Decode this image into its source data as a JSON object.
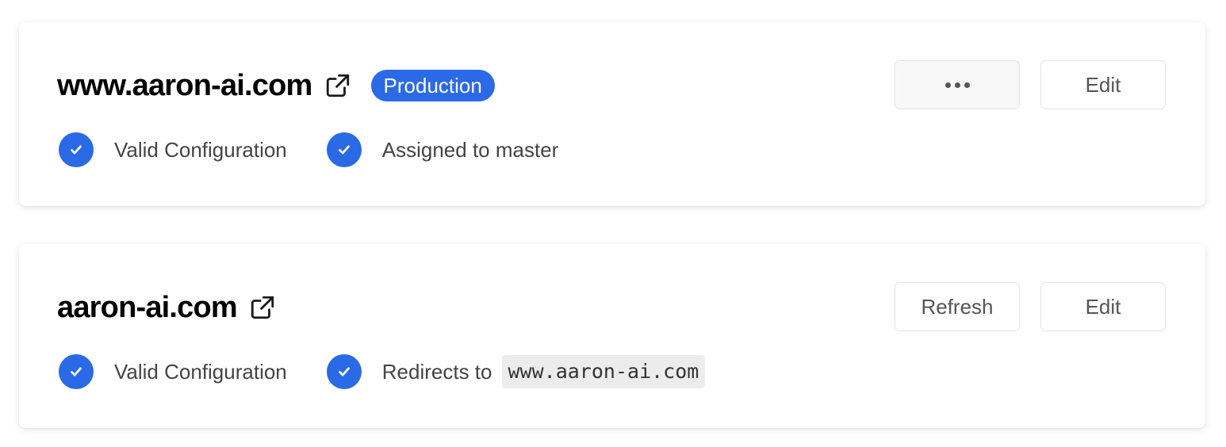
{
  "domains": [
    {
      "title": "www.aaron-ai.com",
      "badge": "Production",
      "statuses": [
        {
          "label": "Valid Configuration"
        },
        {
          "label": "Assigned to master"
        }
      ],
      "actions": {
        "more_icon": "more-horizontal-icon",
        "edit_label": "Edit"
      }
    },
    {
      "title": "aaron-ai.com",
      "statuses": [
        {
          "label": "Valid Configuration"
        },
        {
          "label": "Redirects to",
          "code": "www.aaron-ai.com"
        }
      ],
      "actions": {
        "refresh_label": "Refresh",
        "edit_label": "Edit"
      }
    }
  ],
  "icons": {
    "external_link": "external-link-icon",
    "status": "check-circle-icon"
  },
  "colors": {
    "accent": "#2b6ae6",
    "badge_text": "#ffffff",
    "status_text": "#444444",
    "code_bg": "#ececec"
  }
}
